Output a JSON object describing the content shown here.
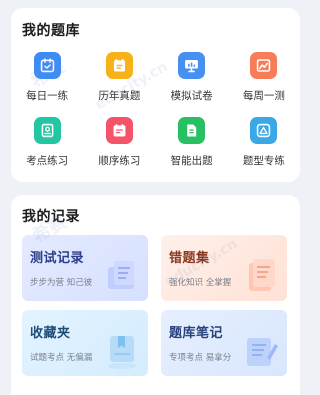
{
  "question_bank": {
    "title": "我的题库",
    "items": [
      {
        "label": "每日一练",
        "icon": "calendar-check-icon",
        "color": "#3d8cf5"
      },
      {
        "label": "历年真题",
        "icon": "exam-paper-icon",
        "color": "#f7b219"
      },
      {
        "label": "模拟试卷",
        "icon": "presentation-board-icon",
        "color": "#4690f0"
      },
      {
        "label": "每周一测",
        "icon": "image-chart-icon",
        "color": "#f77d59"
      },
      {
        "label": "考点练习",
        "icon": "certificate-icon",
        "color": "#22c6a1"
      },
      {
        "label": "顺序练习",
        "icon": "calendar-list-icon",
        "color": "#f5536a"
      },
      {
        "label": "智能出题",
        "icon": "smart-document-icon",
        "color": "#28c062"
      },
      {
        "label": "题型专练",
        "icon": "triangle-badge-icon",
        "color": "#3aa8e6"
      }
    ]
  },
  "records": {
    "title": "我的记录",
    "items": [
      {
        "title": "测试记录",
        "subtitle": "步步为营 知己彼",
        "art": "test-record-illustration-icon"
      },
      {
        "title": "错题集",
        "subtitle": "强化知识 全掌握",
        "art": "wrong-question-illustration-icon"
      },
      {
        "title": "收藏夹",
        "subtitle": "试题考点 无偏漏",
        "art": "favorites-illustration-icon"
      },
      {
        "title": "题库笔记",
        "subtitle": "专项考点 易拿分",
        "art": "notes-illustration-icon"
      }
    ]
  },
  "watermark": {
    "brand": "希赛",
    "domain": "educity.cn"
  }
}
